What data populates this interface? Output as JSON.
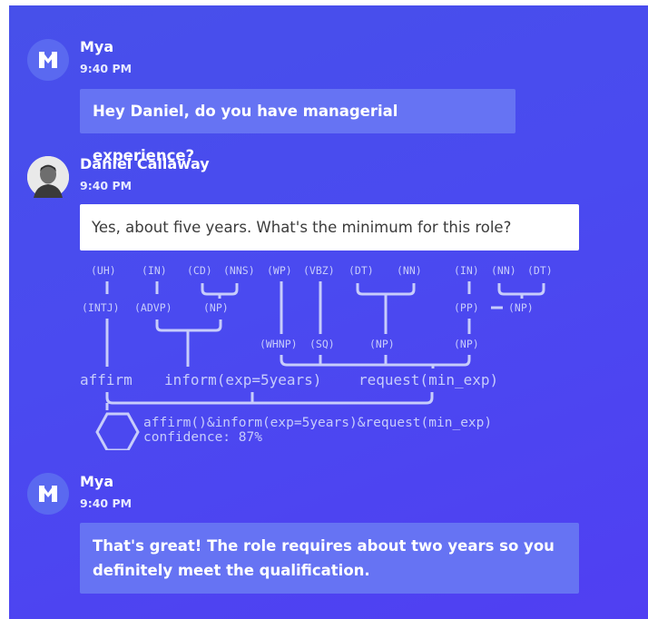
{
  "messages": [
    {
      "sender": "Mya",
      "time": "9:40 PM",
      "text": "Hey Daniel, do you have managerial experience?"
    },
    {
      "sender": "Daniel Callaway",
      "time": "9:40 PM",
      "text": "Yes, about five years. What's the minimum for this role?"
    },
    {
      "sender": "Mya",
      "time": "9:40 PM",
      "text": "That's great! The role requires about two years so you definitely meet the qualification."
    }
  ],
  "parse": {
    "word_tags": [
      "(UH)",
      "(IN)",
      "(CD)",
      "(NNS)",
      "(WP)",
      "(VBZ)",
      "(DT)",
      "(NN)",
      "(IN)",
      "(NN)",
      "(DT)"
    ],
    "phrase_tags": [
      "(INTJ)",
      "(ADVP)",
      "(NP)",
      "(PP)",
      "(NP)",
      "(WHNP)",
      "(SQ)",
      "(NP)",
      "(NP)"
    ],
    "acts": [
      "affirm",
      "inform(exp=5years)",
      "request(min_exp)"
    ],
    "result": "affirm()&inform(exp=5years)&request(min_exp)",
    "confidence": "confidence: 87%"
  },
  "colors": {
    "panel": "#4a4af0",
    "bot_bubble": "#6673f3",
    "user_bubble": "#ffffff",
    "diagram": "#c7ccfb"
  }
}
